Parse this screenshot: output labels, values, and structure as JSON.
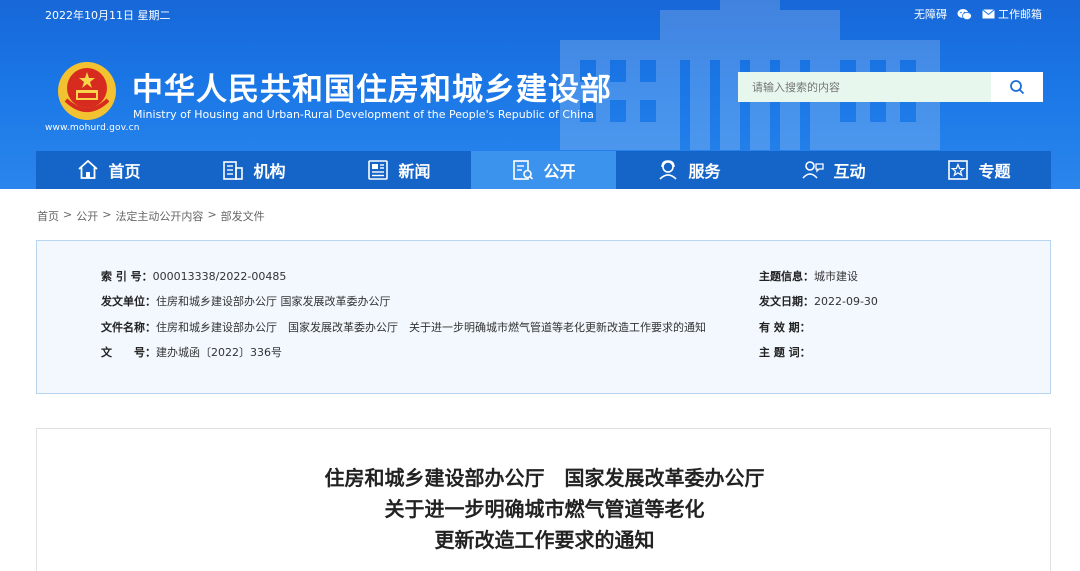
{
  "header": {
    "date": "2022年10月11日 星期二",
    "accessibility": "无障碍",
    "work_mail": "工作邮箱",
    "title_cn": "中华人民共和国住房和城乡建设部",
    "title_en": "Ministry of Housing and Urban-Rural Development of the People's Republic of China",
    "site_url": "www.mohurd.gov.cn",
    "search_placeholder": "请输入搜索的内容"
  },
  "nav": {
    "items": [
      {
        "label": "首页",
        "icon": "home-icon"
      },
      {
        "label": "机构",
        "icon": "building-icon"
      },
      {
        "label": "新闻",
        "icon": "news-icon"
      },
      {
        "label": "公开",
        "icon": "disclosure-icon"
      },
      {
        "label": "服务",
        "icon": "service-icon"
      },
      {
        "label": "互动",
        "icon": "interaction-icon"
      },
      {
        "label": "专题",
        "icon": "star-icon"
      }
    ],
    "active_index": 3
  },
  "breadcrumb": [
    "首页",
    "公开",
    "法定主动公开内容",
    "部发文件"
  ],
  "info": {
    "index_label": "索 引 号：",
    "index_value": "000013338/2022-00485",
    "issuer_label": "发文单位：",
    "issuer_value": "住房和城乡建设部办公厅 国家发展改革委办公厅",
    "docname_label": "文件名称：",
    "docname_value": "住房和城乡建设部办公厅　国家发展改革委办公厅　关于进一步明确城市燃气管道等老化更新改造工作要求的通知",
    "docno_label": "文　　号：",
    "docno_value": "建办城函〔2022〕336号",
    "topic_label": "主题信息：",
    "topic_value": "城市建设",
    "date_label": "发文日期：",
    "date_value": "2022-09-30",
    "validity_label": "有 效 期：",
    "keywords_label": "主 题 词："
  },
  "article": {
    "title_lines": [
      "住房和城乡建设部办公厅　国家发展改革委办公厅",
      "关于进一步明确城市燃气管道等老化",
      "更新改造工作要求的通知"
    ]
  },
  "colors": {
    "header_blue": "#1b77e6",
    "nav_blue": "#1565c8",
    "nav_active": "#3b93ee",
    "info_bg": "#f2f8fe"
  }
}
